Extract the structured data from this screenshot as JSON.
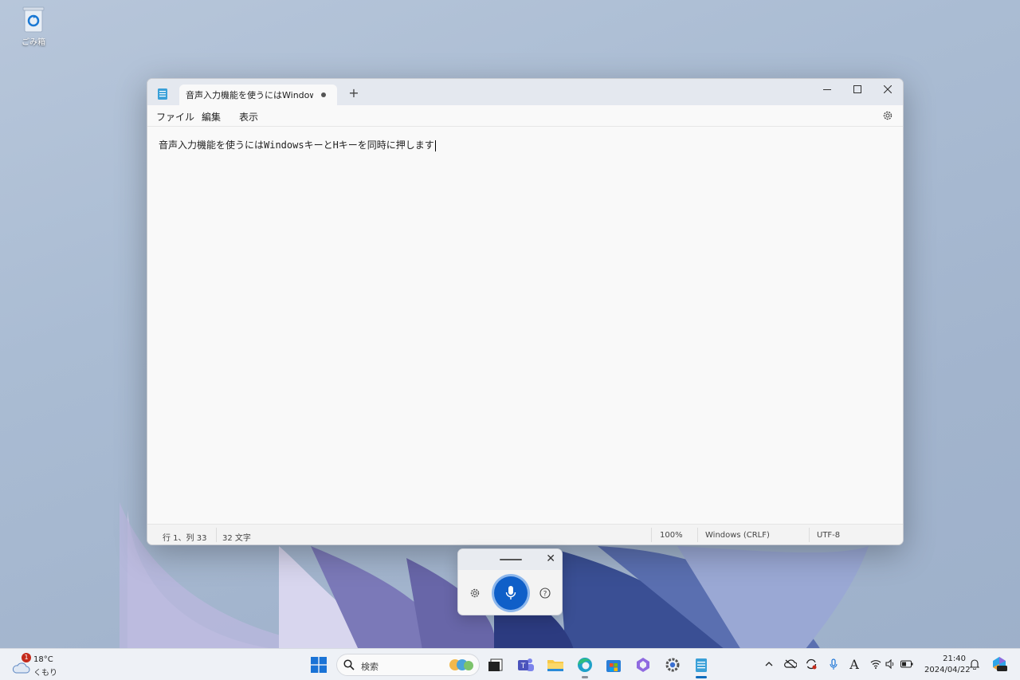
{
  "desktop": {
    "recycle_bin_label": "ごみ箱"
  },
  "window": {
    "tab_title": "音声入力機能を使うにはWindowsキーと",
    "menu": [
      "ファイル",
      "編集",
      "表示"
    ],
    "editor_text": "音声入力機能を使うにはWindowsキーとHキーを同時に押します",
    "status": {
      "position": "行 1、列 33",
      "char_count": "32 文字",
      "zoom": "100%",
      "line_ending": "Windows (CRLF)",
      "encoding": "UTF-8"
    }
  },
  "voice_typing": {
    "icons": [
      "drag-handle-icon",
      "close-icon",
      "gear-icon",
      "microphone-icon",
      "help-icon"
    ]
  },
  "taskbar": {
    "weather": {
      "badge": "1",
      "temperature": "18°C",
      "condition": "くもり"
    },
    "search_placeholder": "検索",
    "clock": {
      "time": "21:40",
      "date": "2024/04/22"
    },
    "ime_indicator": "A",
    "pinned_apps": [
      "start",
      "search",
      "widgets",
      "terminal",
      "teams",
      "file-explorer",
      "edge",
      "store",
      "copilot",
      "settings",
      "notepad"
    ]
  },
  "colors": {
    "accent": "#0f5fc8",
    "titlebar": "#e4e8ef",
    "taskbar": "#eef1f6"
  }
}
